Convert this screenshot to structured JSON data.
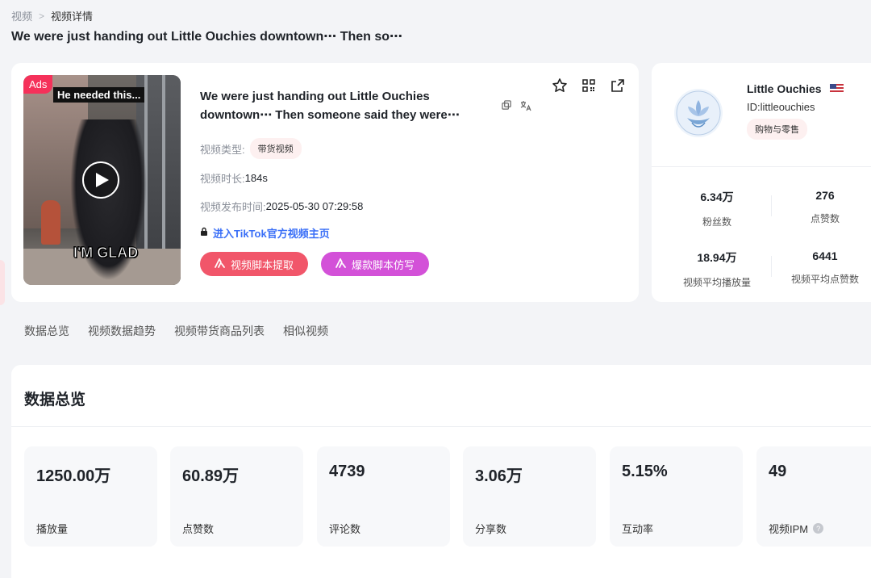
{
  "breadcrumb": {
    "root": "视频",
    "current": "视频详情"
  },
  "page_title": "We were just handing out Little Ouchies downtown⋯ Then so⋯",
  "video": {
    "ads_badge": "Ads",
    "thumb_caption_top": "He needed this...",
    "thumb_caption_bottom": "I'M GLAD",
    "title": "We were just handing out Little Ouchies downtown⋯ Then someone said they were⋯",
    "type_label": "视频类型:",
    "type_value": "带货视频",
    "duration_label": "视频时长:",
    "duration_value": "184s",
    "publish_label": "视频发布时间:",
    "publish_value": "2025-05-30 07:29:58",
    "tiktok_link": "进入TikTok官方视频主页",
    "btn_script": "视频脚本提取",
    "btn_copy": "爆款脚本仿写"
  },
  "author": {
    "name": "Little Ouchies",
    "id": "ID:littleouchies",
    "tag": "购物与零售",
    "stats": [
      {
        "value": "6.34万",
        "label": "粉丝数"
      },
      {
        "value": "276",
        "label": "点赞数"
      },
      {
        "value": "18.94万",
        "label": "视频平均播放量"
      },
      {
        "value": "6441",
        "label": "视频平均点赞数"
      }
    ]
  },
  "tabs": [
    "数据总览",
    "视频数据趋势",
    "视频带货商品列表",
    "相似视频"
  ],
  "overview": {
    "title": "数据总览",
    "metrics": [
      {
        "value": "1250.00万",
        "label": "播放量"
      },
      {
        "value": "60.89万",
        "label": "点赞数"
      },
      {
        "value": "4739",
        "label": "评论数"
      },
      {
        "value": "3.06万",
        "label": "分享数"
      },
      {
        "value": "5.15%",
        "label": "互动率"
      },
      {
        "value": "49",
        "label": "视频IPM"
      }
    ]
  }
}
